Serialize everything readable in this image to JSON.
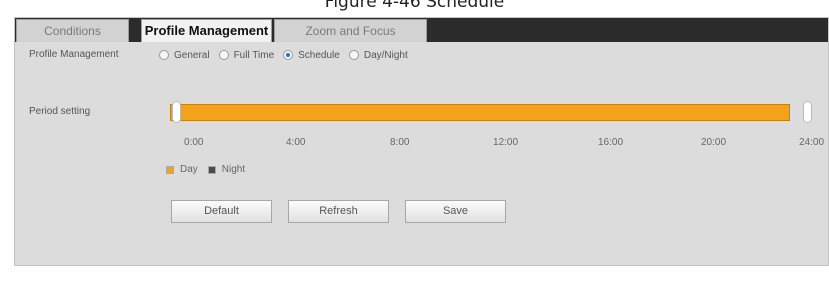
{
  "caption": "Figure 4-46 Schedule",
  "tabs": [
    {
      "label": "Conditions",
      "active": false
    },
    {
      "label": "Profile Management",
      "active": true
    },
    {
      "label": "Zoom and Focus",
      "active": false
    }
  ],
  "profile": {
    "label": "Profile Management",
    "options": [
      "General",
      "Full Time",
      "Schedule",
      "Day/Night"
    ],
    "selected": "Schedule"
  },
  "period": {
    "label": "Period setting",
    "ticks": [
      "0:00",
      "4:00",
      "8:00",
      "12:00",
      "16:00",
      "20:00",
      "24:00"
    ],
    "day_range": [
      "0:00",
      "24:00"
    ]
  },
  "legend": {
    "day": "Day",
    "night": "Night",
    "day_color": "#f4a21a",
    "night_color": "#4a4a4a"
  },
  "buttons": {
    "default": "Default",
    "refresh": "Refresh",
    "save": "Save"
  }
}
